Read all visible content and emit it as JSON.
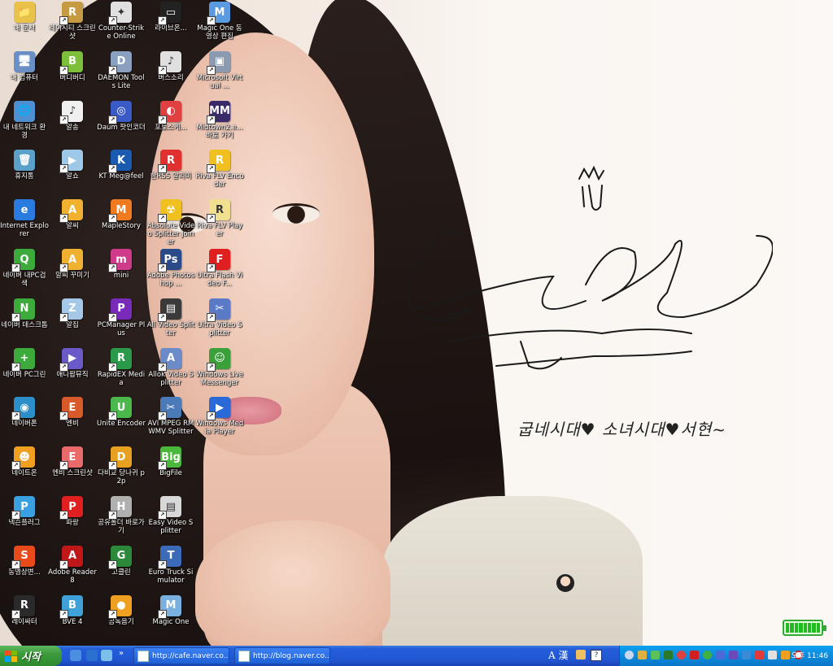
{
  "desktop": {
    "columns": [
      [
        {
          "label": "내 문서",
          "color": "#e9c24a",
          "glyph": "📁",
          "shortcut": false
        },
        {
          "label": "내 컴퓨터",
          "color": "#6a8fc7",
          "glyph": "🖥",
          "shortcut": false
        },
        {
          "label": "내 네트워크 환경",
          "color": "#4d8fd1",
          "glyph": "🌐",
          "shortcut": false
        },
        {
          "label": "휴지통",
          "color": "#5aa0c8",
          "glyph": "🗑",
          "shortcut": false
        },
        {
          "label": "Internet Explorer",
          "color": "#2a7be0",
          "glyph": "e",
          "shortcut": false
        },
        {
          "label": "네이버 내PC검색",
          "color": "#3cab3c",
          "glyph": "Q",
          "shortcut": true
        },
        {
          "label": "네이버 데스크톱",
          "color": "#3cab3c",
          "glyph": "N",
          "shortcut": true
        },
        {
          "label": "네이버 PC그린",
          "color": "#3cab3c",
          "glyph": "+",
          "shortcut": true
        },
        {
          "label": "네이버폰",
          "color": "#2d8fc9",
          "glyph": "◉",
          "shortcut": true
        },
        {
          "label": "네이트온",
          "color": "#f0a020",
          "glyph": "☻",
          "shortcut": true
        },
        {
          "label": "넥슨플러그",
          "color": "#3aa0e0",
          "glyph": "P",
          "shortcut": true
        },
        {
          "label": "동영상변...",
          "color": "#e84a1a",
          "glyph": "S",
          "shortcut": true
        },
        {
          "label": "레이싸터",
          "color": "#2a2a2a",
          "glyph": "R",
          "shortcut": true
        }
      ],
      [
        {
          "label": "레이시티 스크린샷",
          "color": "#c59a43",
          "glyph": "R",
          "shortcut": true
        },
        {
          "label": "버디버디",
          "color": "#7cbf3a",
          "glyph": "B",
          "shortcut": true
        },
        {
          "label": "알송",
          "color": "#f0f0f0",
          "glyph": "♪",
          "shortcut": true
        },
        {
          "label": "알쇼",
          "color": "#9ec8e8",
          "glyph": "▶",
          "shortcut": true
        },
        {
          "label": "알씨",
          "color": "#f0b030",
          "glyph": "A",
          "shortcut": true
        },
        {
          "label": "알씨 꾸미기",
          "color": "#f0b030",
          "glyph": "A",
          "shortcut": true
        },
        {
          "label": "알집",
          "color": "#a5c8e8",
          "glyph": "Z",
          "shortcut": true
        },
        {
          "label": "애니팝뮤직",
          "color": "#6a5ac8",
          "glyph": "▶",
          "shortcut": true
        },
        {
          "label": "엔비",
          "color": "#d85a2a",
          "glyph": "E",
          "shortcut": true
        },
        {
          "label": "엔비 스크린샷",
          "color": "#e86a6a",
          "glyph": "E",
          "shortcut": true
        },
        {
          "label": "파랑",
          "color": "#e02020",
          "glyph": "P",
          "shortcut": true
        },
        {
          "label": "Adobe Reader 8",
          "color": "#c01818",
          "glyph": "A",
          "shortcut": true
        },
        {
          "label": "BVE 4",
          "color": "#40a0d8",
          "glyph": "B",
          "shortcut": true
        }
      ],
      [
        {
          "label": "Counter-Strike Online",
          "color": "#e0e0e0",
          "glyph": "✦",
          "shortcut": true
        },
        {
          "label": "DAEMON Tools Lite",
          "color": "#8aa0c0",
          "glyph": "D",
          "shortcut": true
        },
        {
          "label": "Daum 팟인코더",
          "color": "#3a5ac8",
          "glyph": "◎",
          "shortcut": true
        },
        {
          "label": "KT Meg@feel",
          "color": "#1a5ab0",
          "glyph": "K",
          "shortcut": true
        },
        {
          "label": "MapleStory",
          "color": "#f07a20",
          "glyph": "M",
          "shortcut": true
        },
        {
          "label": "mini",
          "color": "#d03a8a",
          "glyph": "m",
          "shortcut": true
        },
        {
          "label": "PCManager Plus",
          "color": "#7a2ab8",
          "glyph": "P",
          "shortcut": true
        },
        {
          "label": "RapidEX Media",
          "color": "#2a9a4a",
          "glyph": "R",
          "shortcut": true
        },
        {
          "label": "Unite Encoder",
          "color": "#4ab84a",
          "glyph": "U",
          "shortcut": true
        },
        {
          "label": "다비교 당나귀 p2p",
          "color": "#e8a020",
          "glyph": "D",
          "shortcut": true
        },
        {
          "label": "공유폴더 바로가기",
          "color": "#b0b0b0",
          "glyph": "H",
          "shortcut": true
        },
        {
          "label": "고클린",
          "color": "#2a8a3a",
          "glyph": "G",
          "shortcut": true
        },
        {
          "label": "곰녹음기",
          "color": "#f0a020",
          "glyph": "●",
          "shortcut": true
        }
      ],
      [
        {
          "label": "라이브온...",
          "color": "#222222",
          "glyph": "▭",
          "shortcut": true
        },
        {
          "label": "버스소리",
          "color": "#e0e0e0",
          "glyph": "♪",
          "shortcut": true
        },
        {
          "label": "포토스케...",
          "color": "#e04040",
          "glyph": "◐",
          "shortcut": true
        },
        {
          "label": "한RSS 알리미",
          "color": "#e03030",
          "glyph": "R",
          "shortcut": true
        },
        {
          "label": "Absolute Video Splitter Joiner",
          "color": "#f0c020",
          "glyph": "☢",
          "shortcut": true
        },
        {
          "label": "Adobe Photoshop ...",
          "color": "#2a4a8a",
          "glyph": "Ps",
          "shortcut": true
        },
        {
          "label": "All Video Splitter",
          "color": "#3a3a3a",
          "glyph": "▤",
          "shortcut": true
        },
        {
          "label": "Allok Video Splitter",
          "color": "#6a8ac8",
          "glyph": "A",
          "shortcut": true
        },
        {
          "label": "AVI MPEG RM WMV Splitter",
          "color": "#4a7ab8",
          "glyph": "✂",
          "shortcut": true
        },
        {
          "label": "BigFile",
          "color": "#4ab83a",
          "glyph": "Big",
          "shortcut": true
        },
        {
          "label": "Easy Video Splitter",
          "color": "#d8d8d8",
          "glyph": "▤",
          "shortcut": true
        },
        {
          "label": "Euro Truck Simulator",
          "color": "#3a6ab8",
          "glyph": "T",
          "shortcut": true
        },
        {
          "label": "Magic One",
          "color": "#7ab0e0",
          "glyph": "M",
          "shortcut": true
        }
      ],
      [
        {
          "label": "Magic One 동영상 편집",
          "color": "#5a9ae0",
          "glyph": "M",
          "shortcut": true
        },
        {
          "label": "Microsoft Virtual ...",
          "color": "#8a9ab0",
          "glyph": "▣",
          "shortcut": true
        },
        {
          "label": "Midtown2.e... 바로 가기",
          "color": "#3a2a6a",
          "glyph": "MM",
          "shortcut": true
        },
        {
          "label": "Riva FLV Encoder",
          "color": "#f0c020",
          "glyph": "R",
          "shortcut": true
        },
        {
          "label": "Riva FLV Player",
          "color": "#f0e090",
          "glyph": "R",
          "shortcut": true
        },
        {
          "label": "Ultra Flash Video F...",
          "color": "#e02020",
          "glyph": "F",
          "shortcut": true
        },
        {
          "label": "Ultra Video Splitter",
          "color": "#5a7ac8",
          "glyph": "✂",
          "shortcut": true
        },
        {
          "label": "Windows Live Messenger",
          "color": "#3aa03a",
          "glyph": "☺",
          "shortcut": true
        },
        {
          "label": "Windows Media Player",
          "color": "#2a6ad8",
          "glyph": "▶",
          "shortcut": true
        }
      ]
    ]
  },
  "wallpaper": {
    "signature_text": "굽네시대♥ 소녀시대♥서현~"
  },
  "taskbar": {
    "start_label": "시작",
    "tasks": [
      {
        "label": "http://cafe.naver.co..."
      },
      {
        "label": "http://blog.naver.co..."
      }
    ],
    "language_indicator": "A 漢",
    "clock": "오후 11:46"
  }
}
